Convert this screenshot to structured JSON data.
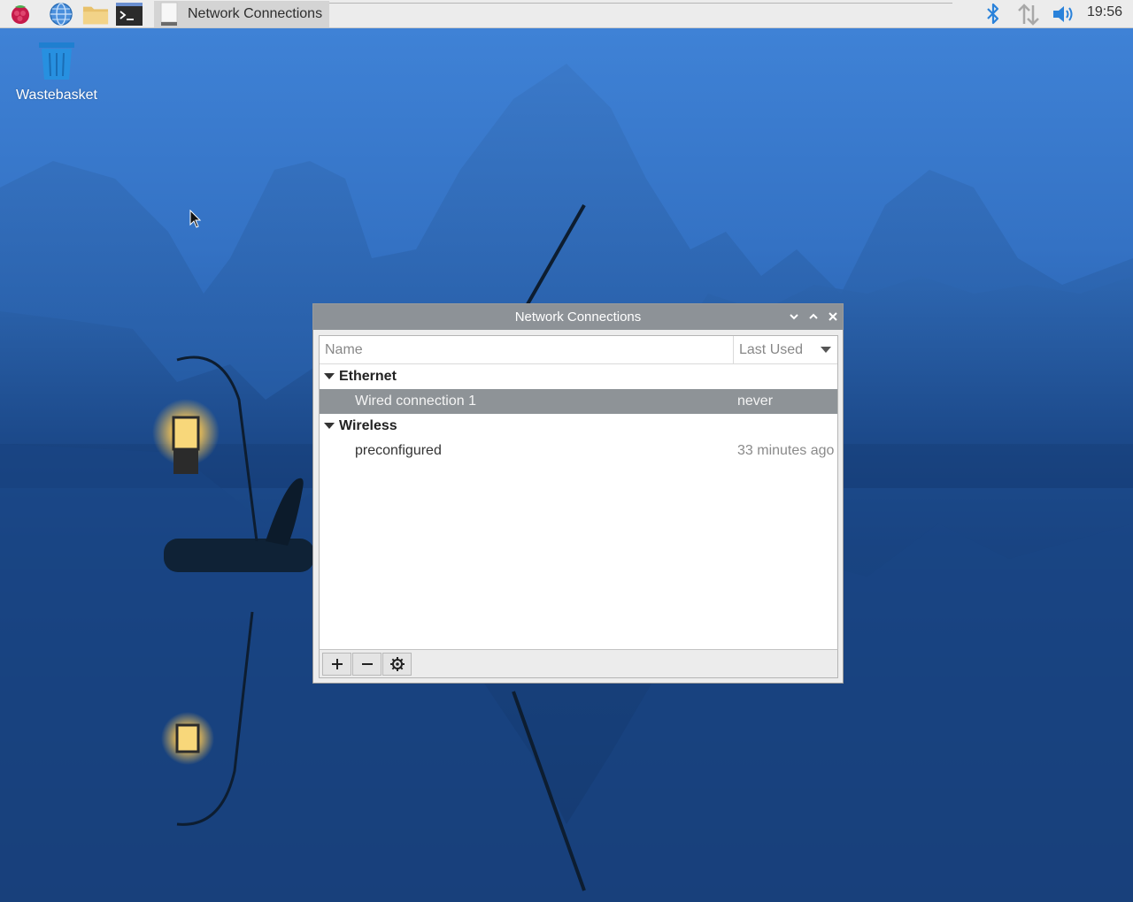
{
  "taskbar": {
    "launchers": [
      {
        "icon": "raspberry-menu-icon"
      },
      {
        "icon": "web-browser-icon"
      },
      {
        "icon": "file-manager-icon"
      },
      {
        "icon": "terminal-icon"
      }
    ],
    "task": {
      "label": "Network Connections",
      "icon": "network-connections-task-icon"
    },
    "tray": [
      {
        "icon": "bluetooth-icon",
        "color": "#2a82da"
      },
      {
        "icon": "network-updown-icon"
      },
      {
        "icon": "volume-icon",
        "color": "#2a82da"
      }
    ],
    "clock": "19:56"
  },
  "desktop": {
    "icons": [
      {
        "label": "Wastebasket",
        "icon": "trash-icon"
      }
    ]
  },
  "window": {
    "title": "Network Connections",
    "columns": {
      "name": "Name",
      "last_used": "Last Used"
    },
    "groups": [
      {
        "label": "Ethernet",
        "connections": [
          {
            "name": "Wired connection 1",
            "last_used": "never",
            "selected": true
          }
        ]
      },
      {
        "label": "Wireless",
        "connections": [
          {
            "name": "preconfigured",
            "last_used": "33 minutes ago",
            "selected": false
          }
        ]
      }
    ],
    "toolbar": [
      {
        "icon": "add-icon",
        "action": "add"
      },
      {
        "icon": "remove-icon",
        "action": "remove"
      },
      {
        "icon": "settings-gear-icon",
        "action": "edit"
      }
    ]
  },
  "colors": {
    "titlebar": "#8d9297",
    "selection": "#8e9397",
    "accent": "#2a82da"
  }
}
